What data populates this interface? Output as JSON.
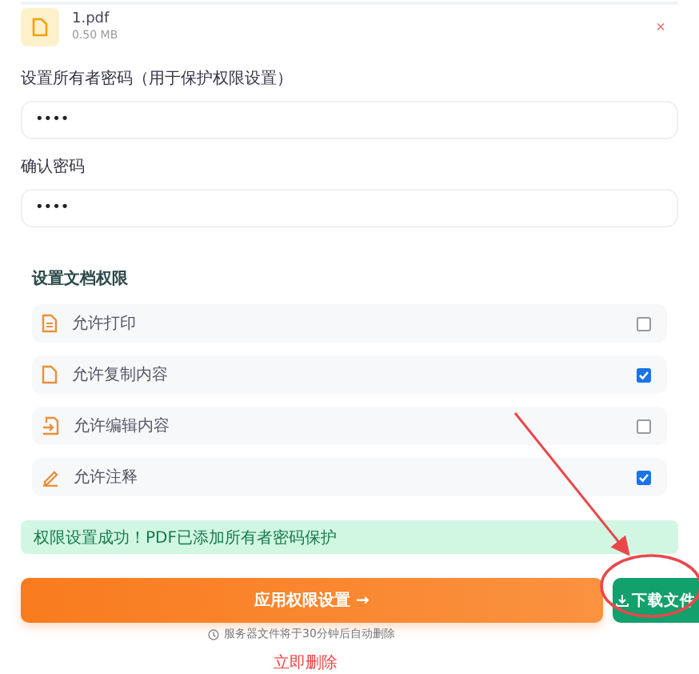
{
  "file": {
    "name": "1.pdf",
    "size": "0.50 MB",
    "remove": "×"
  },
  "fields": [
    {
      "label": "设置所有者密码（用于保护权限设置）",
      "value": "••••"
    },
    {
      "label": "确认密码",
      "value": "••••"
    }
  ],
  "permissions": {
    "title": "设置文档权限",
    "items": [
      {
        "kind": "print",
        "label": "允许打印",
        "checked": false
      },
      {
        "kind": "copy",
        "label": "允许复制内容",
        "checked": true
      },
      {
        "kind": "edit",
        "label": "允许编辑内容",
        "checked": false
      },
      {
        "kind": "annotate",
        "label": "允许注释",
        "checked": true
      }
    ]
  },
  "success": "权限设置成功！PDF已添加所有者密码保护",
  "apply_button": "应用权限设置 →",
  "download_button": "下载文件",
  "hint": "服务器文件将于30分钟后自动删除",
  "delete_link": "立即删除"
}
